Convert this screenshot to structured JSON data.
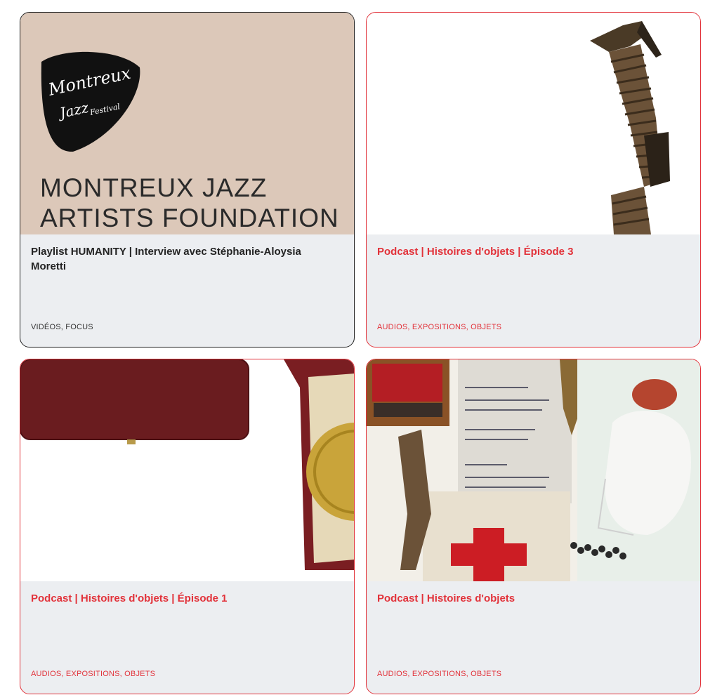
{
  "cards": [
    {
      "title": "Playlist HUMANITY | Interview avec Stéphanie-Aloysia Moretti",
      "tags": "VIDÉOS, FOCUS",
      "banner": {
        "line1": "MONTREUX JAZZ",
        "line2": "ARTISTS FOUNDATION",
        "logo_text_1": "Montreux",
        "logo_text_2": "Jazz",
        "logo_text_3": "Festival"
      }
    },
    {
      "title": "Podcast | Histoires d'objets | Épisode 3",
      "tags": "AUDIOS, EXPOSITIONS, OBJETS"
    },
    {
      "title": "Podcast | Histoires d'objets | Épisode 1",
      "tags": "AUDIOS, EXPOSITIONS, OBJETS"
    },
    {
      "title": "Podcast | Histoires d'objets",
      "tags": "AUDIOS, EXPOSITIONS, OBJETS"
    }
  ],
  "colors": {
    "accent_red": "#e2323a",
    "card_bg": "#eceef1",
    "banner_beige": "#dcc8b9",
    "text_dark": "#232323"
  }
}
